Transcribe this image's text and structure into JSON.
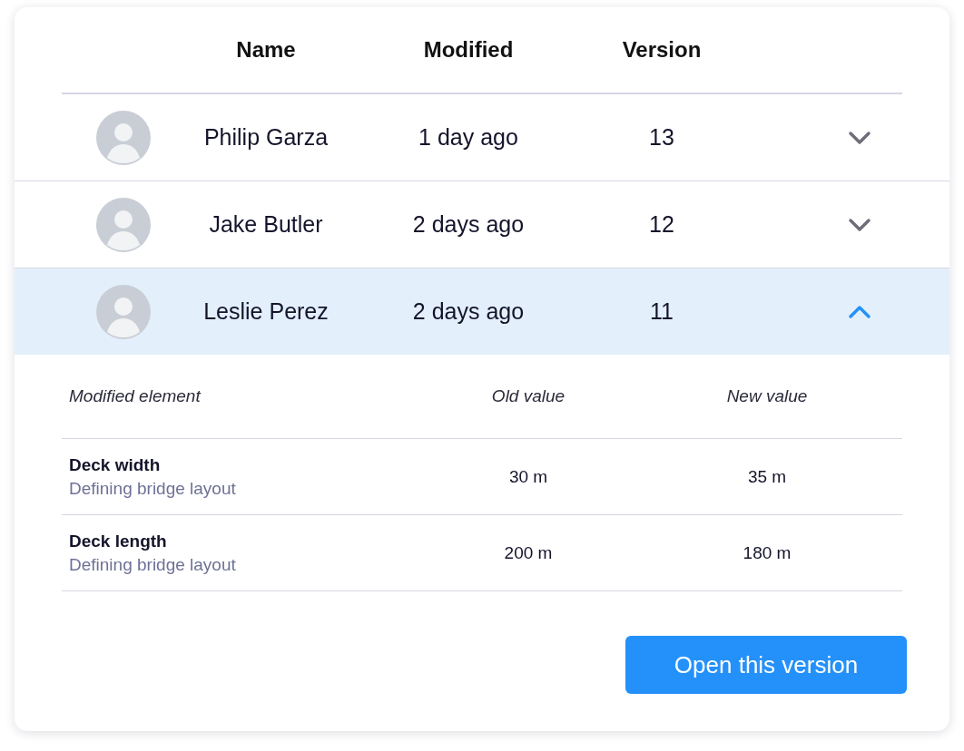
{
  "columns": [
    "Name",
    "Modified",
    "Version"
  ],
  "versions": [
    {
      "name": "Philip Garza",
      "modified": "1 day ago",
      "version": "13",
      "expanded": false
    },
    {
      "name": "Jake Butler",
      "modified": "2 days ago",
      "version": "12",
      "expanded": false
    },
    {
      "name": "Leslie Perez",
      "modified": "2 days ago",
      "version": "11",
      "expanded": true
    }
  ],
  "details": {
    "columns": [
      "Modified element",
      "Old value",
      "New value"
    ],
    "rows": [
      {
        "element": "Deck width",
        "description": "Defining bridge layout",
        "old_value": "30 m",
        "new_value": "35 m"
      },
      {
        "element": "Deck length",
        "description": "Defining bridge layout",
        "old_value": "200 m",
        "new_value": "180 m"
      }
    ]
  },
  "button": "Open this version"
}
